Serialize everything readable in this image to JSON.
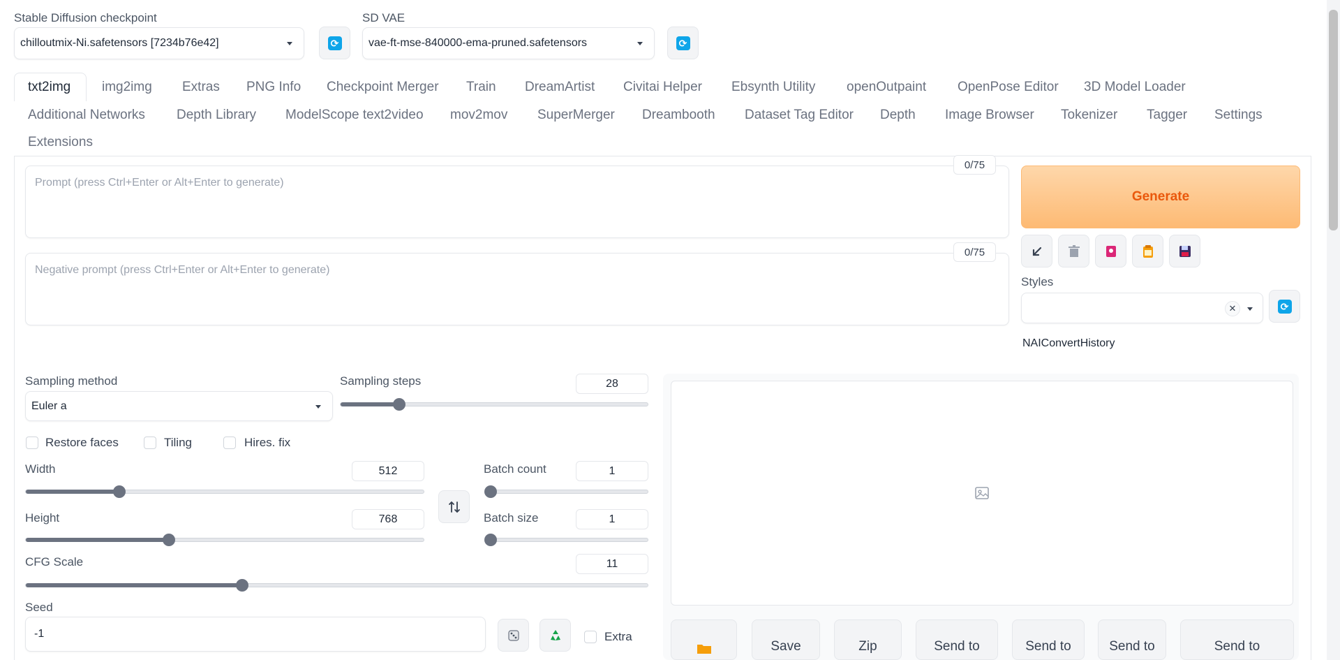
{
  "checkpoint": {
    "label": "Stable Diffusion checkpoint",
    "value": "chilloutmix-Ni.safetensors [7234b76e42]"
  },
  "vae": {
    "label": "SD VAE",
    "value": "vae-ft-mse-840000-ema-pruned.safetensors"
  },
  "tabs_row1": [
    "txt2img",
    "img2img",
    "Extras",
    "PNG Info",
    "Checkpoint Merger",
    "Train",
    "DreamArtist",
    "Civitai Helper",
    "Ebsynth Utility",
    "openOutpaint",
    "OpenPose Editor",
    "3D Model Loader"
  ],
  "tabs_row2": [
    "Additional Networks",
    "Depth Library",
    "ModelScope text2video",
    "mov2mov",
    "SuperMerger",
    "Dreambooth",
    "Dataset Tag Editor",
    "Depth",
    "Image Browser",
    "Tokenizer",
    "Tagger",
    "Settings"
  ],
  "tabs_row3": [
    "Extensions"
  ],
  "active_tab": "txt2img",
  "prompt": {
    "placeholder": "Prompt (press Ctrl+Enter or Alt+Enter to generate)",
    "counter": "0/75"
  },
  "negative_prompt": {
    "placeholder": "Negative prompt (press Ctrl+Enter or Alt+Enter to generate)",
    "counter": "0/75"
  },
  "generate_label": "Generate",
  "styles_label": "Styles",
  "styles_clear": "✕",
  "naiconvert_label": "NAIConvertHistory",
  "sampling_method": {
    "label": "Sampling method",
    "value": "Euler a"
  },
  "sampling_steps": {
    "label": "Sampling steps",
    "value": "28",
    "fraction": 0.19
  },
  "checkboxes": {
    "restore_faces": "Restore faces",
    "tiling": "Tiling",
    "hires_fix": "Hires. fix",
    "extra": "Extra"
  },
  "width": {
    "label": "Width",
    "value": "512",
    "fraction": 0.235
  },
  "height": {
    "label": "Height",
    "value": "768",
    "fraction": 0.36
  },
  "batch_count": {
    "label": "Batch count",
    "value": "1",
    "fraction": 0
  },
  "batch_size": {
    "label": "Batch size",
    "value": "1",
    "fraction": 0
  },
  "cfg_scale": {
    "label": "CFG Scale",
    "value": "11",
    "fraction": 0.348
  },
  "seed": {
    "label": "Seed",
    "value": "-1"
  },
  "output_buttons": [
    "",
    "Save",
    "Zip",
    "Send to",
    "Send to",
    "Send to",
    "Send to"
  ],
  "colors": {
    "accent": "#ea580c",
    "generate_bg_start": "#fed7aa",
    "generate_bg_end": "#fdba74",
    "refresh": "#0ea5e9",
    "slider_fill": "#6b7280"
  },
  "icons": {
    "refresh": "refresh-icon",
    "read_params": "arrow-down-left-icon",
    "trash": "trash-icon",
    "extra_networks": "card-icon",
    "paste_style": "clipboard-icon",
    "save_style": "floppy-disk-icon",
    "swap": "swap-arrows-icon",
    "random_seed": "dice-icon",
    "reuse_seed": "recycle-icon",
    "image_placeholder": "image-icon",
    "open_folder": "folder-icon"
  }
}
